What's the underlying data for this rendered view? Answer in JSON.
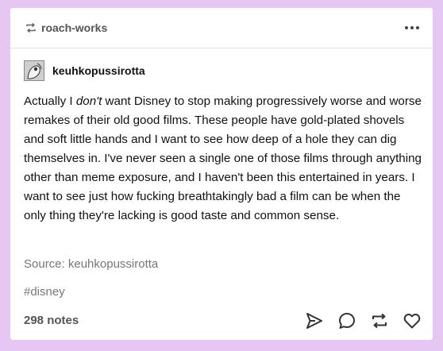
{
  "header": {
    "reblogged_from": "roach-works",
    "reblog_icon": "reblog-icon",
    "more_icon": "more-options-icon"
  },
  "post": {
    "author": "keuhkopussirotta",
    "body": {
      "part1": "Actually I ",
      "emphasis": "don't",
      "part2": " want Disney to stop making progressively worse and worse remakes of their old good films. These people have gold-plated shovels and soft little hands and I want to see how deep of a hole they can dig themselves in. I've never seen a single one of those films through anything other than meme exposure, and I haven't been this entertained in years. I want to see just how fucking breathtakingly bad a film can be when the only thing they're lacking is good taste and common sense."
    },
    "source": "Source: keuhkopussirotta",
    "tag": "#disney"
  },
  "footer": {
    "notes": "298 notes",
    "actions": [
      "share-icon",
      "reply-icon",
      "reblog-icon",
      "like-icon"
    ]
  },
  "colors": {
    "background": "#e6c6f2",
    "card": "#ffffff",
    "muted_text": "#777777"
  }
}
